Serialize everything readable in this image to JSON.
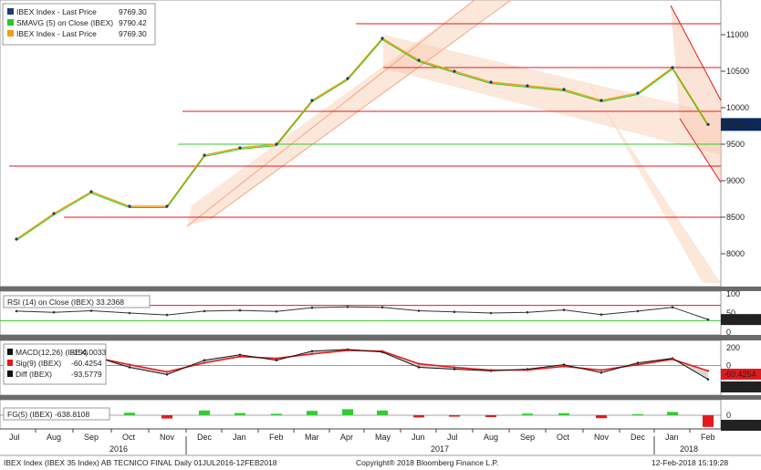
{
  "chart_data": [
    {
      "type": "line",
      "panel": "price",
      "yaxis_ticks": [
        "11000",
        "10500",
        "10000",
        "9500",
        "9000",
        "8500",
        "8000"
      ],
      "ylim": [
        7600,
        11400
      ],
      "grid": false,
      "legend": [
        {
          "label": "IBEX Index - Last Price",
          "value": "9769.30",
          "color": "#1f3b73"
        },
        {
          "label": "SMAVG (5) on Close (IBEX)",
          "value": "9790.42",
          "color": "#22cc22"
        },
        {
          "label": "IBEX Index - Last Price",
          "value": "9769.30",
          "color": "#f39c12"
        }
      ],
      "last_price_label": "9769.30",
      "x": [
        "2016-07",
        "2016-08",
        "2016-09",
        "2016-10",
        "2016-11",
        "2016-12",
        "2017-01",
        "2017-02",
        "2017-03",
        "2017-04",
        "2017-05",
        "2017-06",
        "2017-07",
        "2017-08",
        "2017-09",
        "2017-10",
        "2017-11",
        "2017-12",
        "2018-01",
        "2018-02"
      ],
      "series": [
        {
          "values": [
            8200,
            8550,
            8850,
            8650,
            8650,
            9350,
            9450,
            9500,
            10100,
            10400,
            10950,
            10650,
            10500,
            10350,
            10300,
            10250,
            10100,
            10200,
            10550,
            9770
          ]
        }
      ],
      "horizontal_levels": {
        "red": [
          11150,
          10550,
          9950,
          9200,
          8500
        ],
        "green": [
          9500
        ]
      }
    },
    {
      "type": "line",
      "panel": "rsi",
      "title": "RSI (14) on Close (IBEX) 33.2368",
      "yaxis_ticks": [
        "100",
        "50",
        "0"
      ],
      "ylim": [
        0,
        100
      ],
      "last_value": "33.2368",
      "x": [
        "2016-07",
        "2016-08",
        "2016-09",
        "2016-10",
        "2016-11",
        "2016-12",
        "2017-01",
        "2017-02",
        "2017-03",
        "2017-04",
        "2017-05",
        "2017-06",
        "2017-07",
        "2017-08",
        "2017-09",
        "2017-10",
        "2017-11",
        "2017-12",
        "2018-01",
        "2018-02"
      ],
      "series": [
        {
          "values": [
            55,
            52,
            56,
            50,
            45,
            55,
            57,
            54,
            64,
            66,
            65,
            56,
            53,
            50,
            52,
            58,
            46,
            55,
            65,
            33
          ]
        }
      ],
      "levels": {
        "red": 70,
        "green": 30
      }
    },
    {
      "type": "line",
      "panel": "macd",
      "yaxis_ticks": [
        "200",
        "0"
      ],
      "ylim": [
        -300,
        250
      ],
      "legend": [
        {
          "label": "MACD(12,26) (IBEX)",
          "value": "-154.0033",
          "color": "#111111"
        },
        {
          "label": "Sig(9) (IBEX)",
          "value": "-60.4254",
          "color": "#e31a1c"
        },
        {
          "label": "Diff (IBEX)",
          "value": "-93.5779",
          "color": "#111111"
        }
      ],
      "last_labels": [
        "-60.4254",
        "-154.0033"
      ],
      "x": [
        "2016-07",
        "2016-08",
        "2016-09",
        "2016-10",
        "2016-11",
        "2016-12",
        "2017-01",
        "2017-02",
        "2017-03",
        "2017-04",
        "2017-05",
        "2017-06",
        "2017-07",
        "2017-08",
        "2017-09",
        "2017-10",
        "2017-11",
        "2017-12",
        "2018-01",
        "2018-02"
      ],
      "series": [
        {
          "name": "MACD(12,26) (IBEX)",
          "values": [
            20,
            90,
            110,
            -20,
            -100,
            60,
            120,
            60,
            160,
            180,
            150,
            -20,
            -40,
            -60,
            -40,
            10,
            -80,
            30,
            80,
            -154
          ]
        },
        {
          "name": "Sig(9) (IBEX)",
          "values": [
            0,
            70,
            100,
            10,
            -70,
            30,
            100,
            80,
            130,
            170,
            160,
            20,
            -20,
            -50,
            -50,
            -10,
            -50,
            10,
            70,
            -60
          ]
        }
      ]
    },
    {
      "type": "bar",
      "panel": "fg",
      "title": "FG(5) (IBEX) -638.8108",
      "yaxis_ticks": [
        "0"
      ],
      "last_value": "-638.8108",
      "x": [
        "2016-07",
        "2016-08",
        "2016-09",
        "2016-10",
        "2016-11",
        "2016-12",
        "2017-01",
        "2017-02",
        "2017-03",
        "2017-04",
        "2017-05",
        "2017-06",
        "2017-07",
        "2017-08",
        "2017-09",
        "2017-10",
        "2017-11",
        "2017-12",
        "2018-01",
        "2018-02"
      ],
      "values": [
        120,
        80,
        160,
        140,
        -180,
        260,
        120,
        80,
        240,
        330,
        260,
        -120,
        -80,
        -100,
        90,
        110,
        -160,
        60,
        180,
        -638
      ]
    }
  ],
  "x_axis": {
    "months": [
      "Jul",
      "Aug",
      "Sep",
      "Oct",
      "Nov",
      "Dec",
      "Jan",
      "Feb",
      "Mar",
      "Apr",
      "May",
      "Jun",
      "Jul",
      "Aug",
      "Sep",
      "Oct",
      "Nov",
      "Dec",
      "Jan",
      "Feb"
    ],
    "years": [
      "2016",
      "2017",
      "2018"
    ]
  },
  "footer": {
    "left": "IBEX Index (IBEX 35 Index) AB TECNICO FINAL  Daily 01JUL2016-12FEB2018",
    "center": "Copyright® 2018 Bloomberg Finance L.P.",
    "right": "12-Feb-2018 15:19:28"
  }
}
